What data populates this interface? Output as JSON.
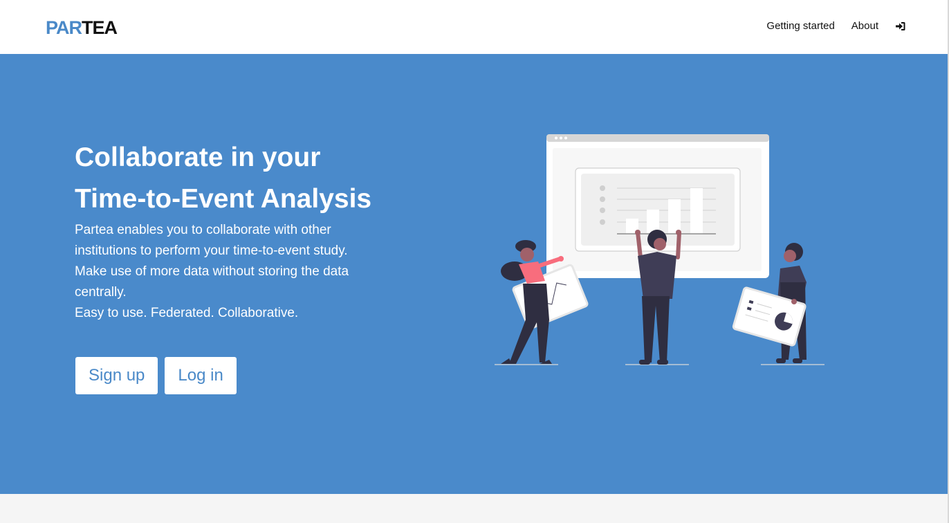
{
  "brand": {
    "part1": "PAR",
    "part2": "TEA"
  },
  "nav": {
    "links": [
      "Getting started",
      "About"
    ],
    "login_icon": "sign-in-icon"
  },
  "hero": {
    "title_line1": "Collaborate in your",
    "title_line2": "Time-to-Event Analysis",
    "text_lines": [
      "Partea enables you to collaborate with other",
      "institutions to perform your time-to-event study.",
      "Make use of more data without storing the data",
      "centrally.",
      "Easy to use. Federated. Collaborative."
    ],
    "signup_label": "Sign up",
    "login_label": "Log in"
  },
  "colors": {
    "hero_bg": "#4a8acb",
    "brand_blue": "#4a89c8",
    "accent_pink": "#f86d7d",
    "figure_dark": "#3f3d56"
  }
}
